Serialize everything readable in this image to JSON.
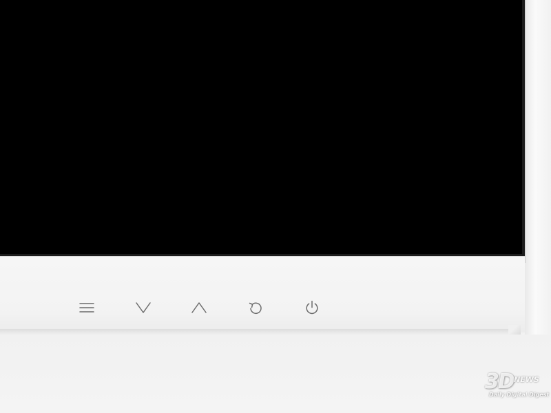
{
  "device": {
    "bezel_color": "#f3f3f3",
    "screen_color": "#000000",
    "icon_color": "#6b6b6b"
  },
  "controls": [
    {
      "icon": "menu-icon"
    },
    {
      "icon": "chevron-down-icon"
    },
    {
      "icon": "chevron-up-icon"
    },
    {
      "icon": "return-icon"
    },
    {
      "icon": "power-icon"
    }
  ],
  "watermark": {
    "brand": "3D",
    "brand_suffix": "NEWS",
    "tagline": "Daily Digital Digest"
  }
}
